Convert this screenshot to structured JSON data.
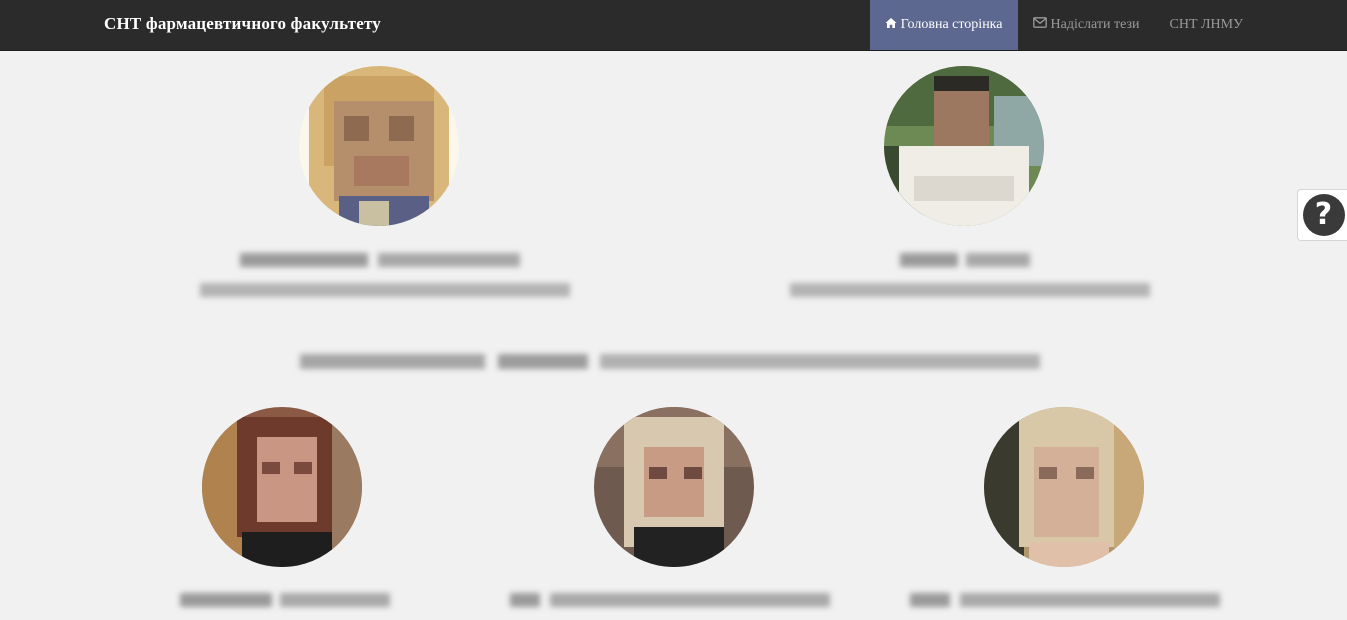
{
  "navbar": {
    "brand": "СНТ фармацевтичного факультету",
    "items": [
      {
        "label": "Головна сторінка",
        "icon": "home-icon",
        "active": true
      },
      {
        "label": "Надіслати тези",
        "icon": "envelope-icon",
        "active": false
      },
      {
        "label": "СНТ ЛНМУ",
        "icon": "",
        "active": false
      }
    ]
  },
  "help": {
    "symbol": "?"
  },
  "colors": {
    "navbar": "#2b2b2b",
    "active_tab": "#5d6890",
    "page_bg": "#f1f1f1"
  }
}
